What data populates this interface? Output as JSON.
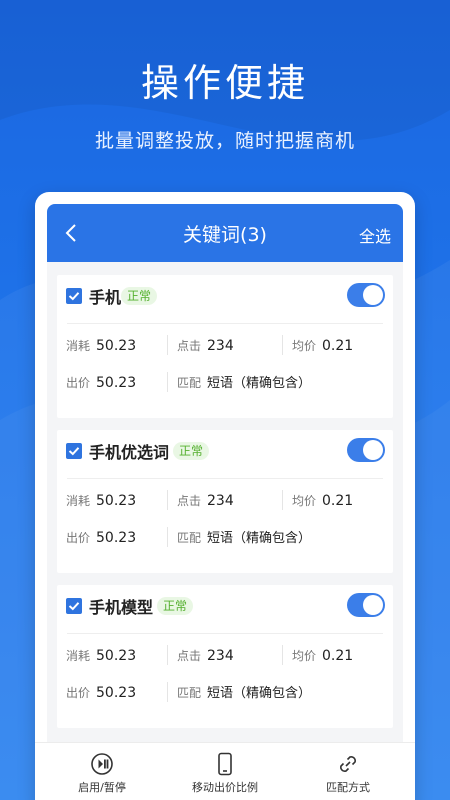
{
  "promo": {
    "title": "操作便捷",
    "subtitle": "批量调整投放，随时把握商机"
  },
  "nav": {
    "title": "关键词(3)",
    "select_all": "全选",
    "back_icon": "chevron-left-icon"
  },
  "labels": {
    "cost": "消耗",
    "clicks": "点击",
    "avg_price": "均价",
    "bid": "出价",
    "match": "匹配"
  },
  "keywords": [
    {
      "name": "手机",
      "status": "正常",
      "checked": true,
      "enabled": true,
      "cost": "50.23",
      "clicks": "234",
      "avg_price": "0.21",
      "bid": "50.23",
      "match": "短语（精确包含）"
    },
    {
      "name": "手机优选词",
      "status": "正常",
      "checked": true,
      "enabled": true,
      "cost": "50.23",
      "clicks": "234",
      "avg_price": "0.21",
      "bid": "50.23",
      "match": "短语（精确包含）"
    },
    {
      "name": "手机模型",
      "status": "正常",
      "checked": true,
      "enabled": true,
      "cost": "50.23",
      "clicks": "234",
      "avg_price": "0.21",
      "bid": "50.23",
      "match": "短语（精确包含）"
    }
  ],
  "actions": [
    {
      "label": "启用/暂停",
      "icon": "play-pause-icon"
    },
    {
      "label": "移动出价比例",
      "icon": "mobile-phone-icon"
    },
    {
      "label": "匹配方式",
      "icon": "link-icon"
    }
  ],
  "colors": {
    "brand_blue": "#2a74e6",
    "status_green": "#55b02f",
    "status_green_bg": "#e9f7e4",
    "toggle_on": "#3b7ee9"
  }
}
